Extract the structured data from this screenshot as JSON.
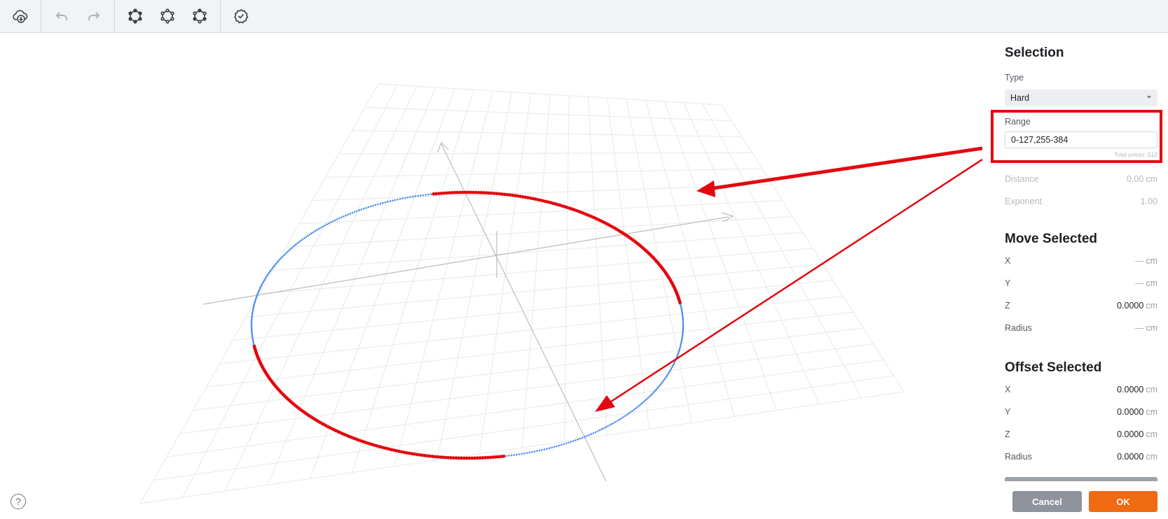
{
  "toolbar": {
    "groups": [
      [
        {
          "icon": "cloud-download-icon",
          "enabled": true
        }
      ],
      [
        {
          "icon": "undo-icon",
          "enabled": false
        },
        {
          "icon": "redo-icon",
          "enabled": false
        }
      ],
      [
        {
          "icon": "select-points-icon",
          "enabled": true
        },
        {
          "icon": "deselect-points-icon",
          "enabled": true
        },
        {
          "icon": "invert-selection-icon",
          "enabled": true
        }
      ],
      [
        {
          "icon": "check-badge-icon",
          "enabled": true
        }
      ]
    ]
  },
  "selection": {
    "title": "Selection",
    "type_label": "Type",
    "type_value": "Hard",
    "range_label": "Range",
    "range_value": "0-127,255-384",
    "total_points": "Total points: 512",
    "distance_label": "Distance",
    "distance_value": "0.00",
    "distance_unit": "cm",
    "exponent_label": "Exponent",
    "exponent_value": "1.00"
  },
  "move_selected": {
    "title": "Move Selected",
    "rows": [
      {
        "label": "X",
        "value": "---",
        "unit": "cm"
      },
      {
        "label": "Y",
        "value": "---",
        "unit": "cm"
      },
      {
        "label": "Z",
        "value": "0.0000",
        "unit": "cm"
      },
      {
        "label": "Radius",
        "value": "---",
        "unit": "cm"
      }
    ]
  },
  "offset_selected": {
    "title": "Offset Selected",
    "rows": [
      {
        "label": "X",
        "value": "0.0000",
        "unit": "cm"
      },
      {
        "label": "Y",
        "value": "0.0000",
        "unit": "cm"
      },
      {
        "label": "Z",
        "value": "0.0000",
        "unit": "cm"
      },
      {
        "label": "Radius",
        "value": "0.0000",
        "unit": "cm"
      }
    ]
  },
  "buttons": {
    "cancel": "Cancel",
    "ok": "OK",
    "help": "?"
  },
  "colors": {
    "selected_points": "#e3070f",
    "unselected_points": "#4a8af0",
    "annotation": "#e3070f",
    "ok_button": "#ef6a10",
    "cancel_button": "#8e939c"
  }
}
